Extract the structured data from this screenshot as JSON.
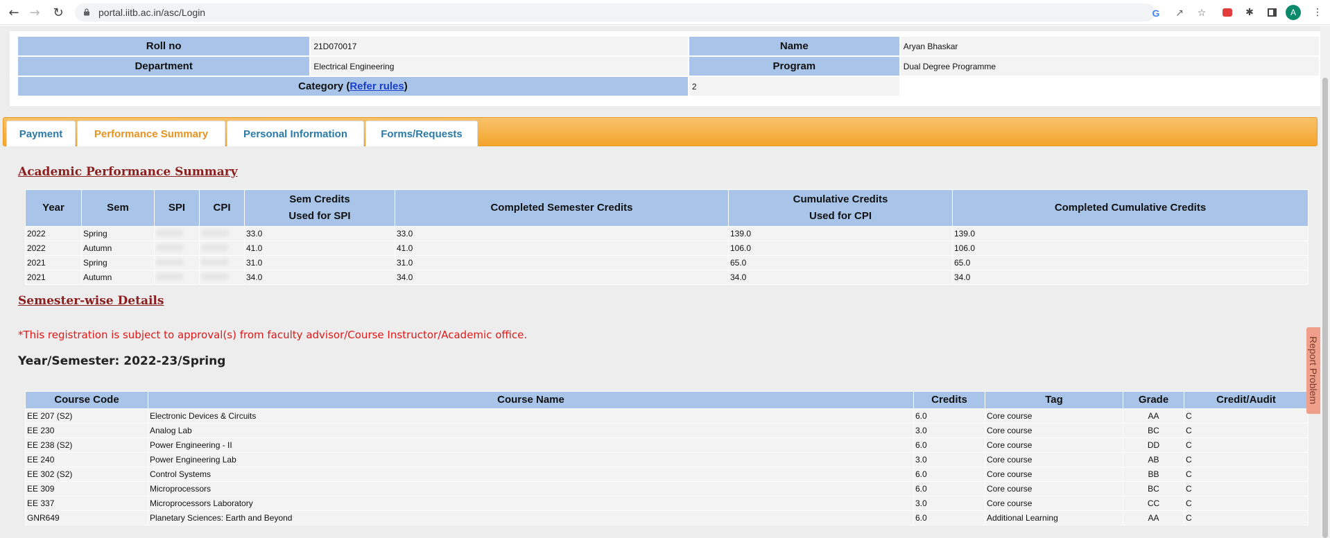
{
  "browser": {
    "url": "portal.iitb.ac.in/asc/Login",
    "avatar_letter": "A"
  },
  "student": {
    "roll_label": "Roll no",
    "roll": "21D070017",
    "name_label": "Name",
    "name": "Aryan Bhaskar",
    "dept_label": "Department",
    "dept": "Electrical Engineering",
    "program_label": "Program",
    "program": "Dual Degree Programme",
    "category_label": "Category (",
    "category_link": "Refer rules",
    "category_close": ")",
    "category": "2"
  },
  "tabs": [
    "Payment",
    "Performance Summary",
    "Personal Information",
    "Forms/Requests"
  ],
  "active_tab": "Performance Summary",
  "summary": {
    "title": "Academic Performance Summary",
    "headers": [
      "Year",
      "Sem",
      "SPI",
      "CPI",
      "Sem Credits\nUsed for SPI",
      "Completed Semester Credits",
      "Cumulative Credits\nUsed for CPI",
      "Completed Cumulative Credits"
    ],
    "rows": [
      [
        "2022",
        "Spring",
        "",
        "",
        "33.0",
        "33.0",
        "139.0",
        "139.0"
      ],
      [
        "2022",
        "Autumn",
        "",
        "",
        "41.0",
        "41.0",
        "106.0",
        "106.0"
      ],
      [
        "2021",
        "Spring",
        "",
        "",
        "31.0",
        "31.0",
        "65.0",
        "65.0"
      ],
      [
        "2021",
        "Autumn",
        "",
        "",
        "34.0",
        "34.0",
        "34.0",
        "34.0"
      ]
    ]
  },
  "semwise": {
    "title": "Semester-wise Details",
    "notice": "*This registration is subject to approval(s) from faculty advisor/Course Instructor/Academic office.",
    "year_sem": "Year/Semester: 2022-23/Spring",
    "headers": [
      "Course Code",
      "Course Name",
      "Credits",
      "Tag",
      "Grade",
      "Credit/Audit"
    ],
    "rows": [
      [
        "EE 207 (S2)",
        "Electronic Devices & Circuits",
        "6.0",
        "Core course",
        "AA",
        "C"
      ],
      [
        "EE 230",
        "Analog Lab",
        "3.0",
        "Core course",
        "BC",
        "C"
      ],
      [
        "EE 238 (S2)",
        "Power Engineering - II",
        "6.0",
        "Core course",
        "DD",
        "C"
      ],
      [
        "EE 240",
        "Power Engineering Lab",
        "3.0",
        "Core course",
        "AB",
        "C"
      ],
      [
        "EE 302 (S2)",
        "Control Systems",
        "6.0",
        "Core course",
        "BB",
        "C"
      ],
      [
        "EE 309",
        "Microprocessors",
        "6.0",
        "Core course",
        "BC",
        "C"
      ],
      [
        "EE 337",
        "Microprocessors Laboratory",
        "3.0",
        "Core course",
        "CC",
        "C"
      ],
      [
        "GNR649",
        "Planetary Sciences: Earth and Beyond",
        "6.0",
        "Additional Learning",
        "AA",
        "C"
      ]
    ]
  },
  "report_problem": "Report Problem"
}
